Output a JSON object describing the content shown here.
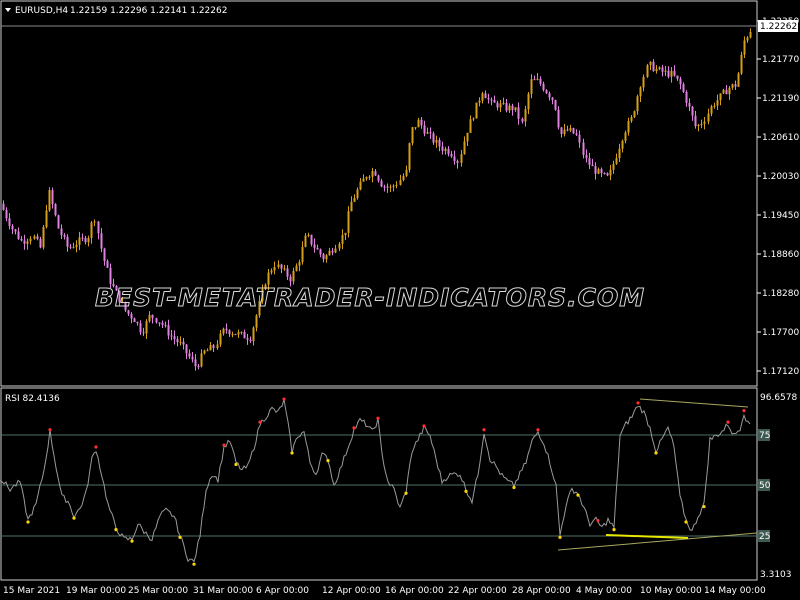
{
  "main": {
    "symbol_title": "EURUSD,H4",
    "ohlc": "1.22159 1.22296 1.22141 1.22262",
    "price_ticks": [
      "1.22350",
      "1.21770",
      "1.21190",
      "1.20610",
      "1.20030",
      "1.19450",
      "1.18860",
      "1.18280",
      "1.17700",
      "1.17120"
    ],
    "current_price": "1.22262",
    "watermark": "BEST-METATRADER-INDICATORS.COM"
  },
  "rsi": {
    "title": "RSI 82.4136",
    "scale_max": "96.6578",
    "scale_min": "3.3103",
    "levels": [
      "75",
      "50",
      "25"
    ]
  },
  "time_ticks": [
    "15 Mar 2021",
    "19 Mar 00:00",
    "25 Mar 00:00",
    "31 Mar 00:00",
    "6 Apr 00:00",
    "12 Apr 00:00",
    "16 Apr 00:00",
    "22 Apr 00:00",
    "28 Apr 00:00",
    "4 May 00:00",
    "10 May 00:00",
    "14 May 00:00"
  ],
  "colors": {
    "bull": "#d4a017",
    "bear": "#e080e0",
    "grid": "#5a7a6a",
    "rsi_line": "#9a9a9a",
    "peak": "#ff3030",
    "trough": "#ffd700",
    "divergence": "#e0e000",
    "trendline": "#a0a060"
  },
  "chart_data": {
    "type": "candlestick",
    "title": "EURUSD,H4",
    "ylim": [
      1.169,
      1.2245
    ],
    "price_path": [
      [
        0,
        1.1962
      ],
      [
        12,
        1.1925
      ],
      [
        22,
        1.1905
      ],
      [
        32,
        1.1915
      ],
      [
        40,
        1.1895
      ],
      [
        48,
        1.1982
      ],
      [
        58,
        1.1925
      ],
      [
        68,
        1.1895
      ],
      [
        78,
        1.1905
      ],
      [
        88,
        1.1912
      ],
      [
        94,
        1.1945
      ],
      [
        102,
        1.1885
      ],
      [
        110,
        1.1845
      ],
      [
        118,
        1.1822
      ],
      [
        126,
        1.18
      ],
      [
        134,
        1.179
      ],
      [
        142,
        1.177
      ],
      [
        150,
        1.1795
      ],
      [
        160,
        1.1785
      ],
      [
        170,
        1.1765
      ],
      [
        180,
        1.1752
      ],
      [
        188,
        1.1735
      ],
      [
        196,
        1.1718
      ],
      [
        204,
        1.174
      ],
      [
        214,
        1.1748
      ],
      [
        224,
        1.1775
      ],
      [
        232,
        1.177
      ],
      [
        242,
        1.1765
      ],
      [
        250,
        1.1762
      ],
      [
        258,
        1.1805
      ],
      [
        266,
        1.185
      ],
      [
        274,
        1.1872
      ],
      [
        282,
        1.1862
      ],
      [
        290,
        1.185
      ],
      [
        298,
        1.1875
      ],
      [
        306,
        1.1915
      ],
      [
        314,
        1.1898
      ],
      [
        324,
        1.188
      ],
      [
        334,
        1.1898
      ],
      [
        344,
        1.1918
      ],
      [
        350,
        1.1962
      ],
      [
        358,
        1.1985
      ],
      [
        366,
        1.2005
      ],
      [
        374,
        1.2012
      ],
      [
        382,
        1.199
      ],
      [
        390,
        1.1985
      ],
      [
        398,
        1.1995
      ],
      [
        406,
        1.201
      ],
      [
        410,
        1.207
      ],
      [
        418,
        1.2085
      ],
      [
        426,
        1.2068
      ],
      [
        434,
        1.2055
      ],
      [
        442,
        1.2045
      ],
      [
        450,
        1.204
      ],
      [
        458,
        1.2025
      ],
      [
        466,
        1.207
      ],
      [
        474,
        1.21
      ],
      [
        482,
        1.2132
      ],
      [
        490,
        1.2112
      ],
      [
        498,
        1.211
      ],
      [
        506,
        1.2105
      ],
      [
        514,
        1.2105
      ],
      [
        522,
        1.208
      ],
      [
        530,
        1.2145
      ],
      [
        538,
        1.2145
      ],
      [
        546,
        1.213
      ],
      [
        554,
        1.2115
      ],
      [
        560,
        1.2065
      ],
      [
        568,
        1.2072
      ],
      [
        576,
        1.2065
      ],
      [
        584,
        1.203
      ],
      [
        592,
        1.2015
      ],
      [
        600,
        1.2005
      ],
      [
        608,
        1.2
      ],
      [
        616,
        1.2035
      ],
      [
        624,
        1.207
      ],
      [
        632,
        1.209
      ],
      [
        640,
        1.214
      ],
      [
        648,
        1.217
      ],
      [
        656,
        1.2162
      ],
      [
        664,
        1.2158
      ],
      [
        672,
        1.2155
      ],
      [
        680,
        1.214
      ],
      [
        688,
        1.211
      ],
      [
        696,
        1.2075
      ],
      [
        704,
        1.2088
      ],
      [
        712,
        1.211
      ],
      [
        720,
        1.2122
      ],
      [
        728,
        1.2135
      ],
      [
        736,
        1.214
      ],
      [
        744,
        1.2205
      ],
      [
        752,
        1.2226
      ]
    ],
    "rsi_path": [
      [
        0,
        54
      ],
      [
        10,
        48
      ],
      [
        20,
        52
      ],
      [
        28,
        32
      ],
      [
        36,
        40
      ],
      [
        44,
        58
      ],
      [
        50,
        78
      ],
      [
        56,
        60
      ],
      [
        62,
        44
      ],
      [
        68,
        42
      ],
      [
        74,
        34
      ],
      [
        80,
        38
      ],
      [
        86,
        46
      ],
      [
        92,
        64
      ],
      [
        96,
        69
      ],
      [
        102,
        55
      ],
      [
        108,
        40
      ],
      [
        116,
        28
      ],
      [
        124,
        22
      ],
      [
        132,
        22
      ],
      [
        138,
        30
      ],
      [
        144,
        26
      ],
      [
        152,
        22
      ],
      [
        160,
        34
      ],
      [
        166,
        37
      ],
      [
        174,
        34
      ],
      [
        180,
        24
      ],
      [
        188,
        12
      ],
      [
        194,
        10
      ],
      [
        200,
        24
      ],
      [
        206,
        48
      ],
      [
        212,
        56
      ],
      [
        218,
        53
      ],
      [
        224,
        70
      ],
      [
        230,
        73
      ],
      [
        236,
        62
      ],
      [
        242,
        58
      ],
      [
        248,
        60
      ],
      [
        254,
        70
      ],
      [
        260,
        82
      ],
      [
        266,
        86
      ],
      [
        272,
        90
      ],
      [
        278,
        88
      ],
      [
        284,
        94
      ],
      [
        288,
        82
      ],
      [
        292,
        68
      ],
      [
        298,
        76
      ],
      [
        304,
        78
      ],
      [
        310,
        62
      ],
      [
        316,
        56
      ],
      [
        322,
        66
      ],
      [
        328,
        64
      ],
      [
        334,
        50
      ],
      [
        340,
        58
      ],
      [
        348,
        70
      ],
      [
        354,
        79
      ],
      [
        360,
        84
      ],
      [
        366,
        82
      ],
      [
        372,
        78
      ],
      [
        378,
        84
      ],
      [
        382,
        66
      ],
      [
        388,
        52
      ],
      [
        394,
        48
      ],
      [
        400,
        38
      ],
      [
        406,
        47
      ],
      [
        412,
        68
      ],
      [
        418,
        74
      ],
      [
        424,
        80
      ],
      [
        430,
        76
      ],
      [
        436,
        64
      ],
      [
        442,
        52
      ],
      [
        448,
        55
      ],
      [
        454,
        56
      ],
      [
        460,
        56
      ],
      [
        466,
        48
      ],
      [
        472,
        42
      ],
      [
        478,
        56
      ],
      [
        484,
        78
      ],
      [
        490,
        64
      ],
      [
        496,
        60
      ],
      [
        502,
        55
      ],
      [
        508,
        52
      ],
      [
        514,
        50
      ],
      [
        520,
        56
      ],
      [
        526,
        62
      ],
      [
        532,
        73
      ],
      [
        538,
        78
      ],
      [
        544,
        72
      ],
      [
        550,
        62
      ],
      [
        556,
        50
      ],
      [
        560,
        24
      ],
      [
        566,
        40
      ],
      [
        572,
        48
      ],
      [
        578,
        46
      ],
      [
        584,
        38
      ],
      [
        590,
        30
      ],
      [
        596,
        32
      ],
      [
        602,
        28
      ],
      [
        608,
        32
      ],
      [
        614,
        28
      ],
      [
        620,
        76
      ],
      [
        626,
        82
      ],
      [
        632,
        86
      ],
      [
        638,
        92
      ],
      [
        644,
        88
      ],
      [
        650,
        80
      ],
      [
        656,
        68
      ],
      [
        662,
        74
      ],
      [
        668,
        80
      ],
      [
        674,
        70
      ],
      [
        680,
        44
      ],
      [
        686,
        32
      ],
      [
        692,
        26
      ],
      [
        698,
        34
      ],
      [
        704,
        40
      ],
      [
        710,
        74
      ],
      [
        716,
        76
      ],
      [
        722,
        78
      ],
      [
        728,
        82
      ],
      [
        734,
        76
      ],
      [
        740,
        80
      ],
      [
        744,
        88
      ],
      [
        748,
        82
      ]
    ],
    "rsi_peaks": [
      50,
      96,
      224,
      260,
      284,
      354,
      378,
      424,
      484,
      538,
      598,
      638,
      728,
      744
    ],
    "rsi_troughs": [
      28,
      74,
      116,
      132,
      180,
      194,
      236,
      292,
      328,
      406,
      466,
      514,
      560,
      578,
      614,
      656,
      686,
      704
    ]
  }
}
